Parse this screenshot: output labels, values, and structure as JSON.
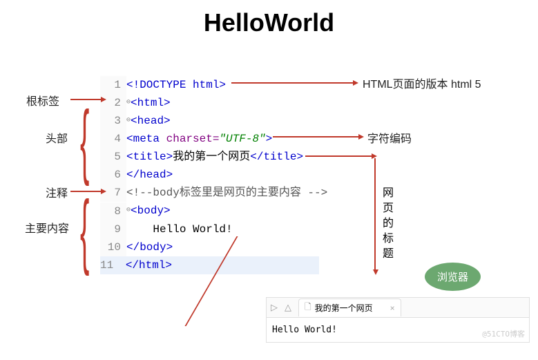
{
  "title": "HelloWorld",
  "code": {
    "l1": "<!DOCTYPE html>",
    "l2": "<html>",
    "l3": "<head>",
    "l4_tag_open": "<meta ",
    "l4_attr": "charset=",
    "l4_val": "\"UTF-8\"",
    "l4_tag_close": ">",
    "l5_open": "<title>",
    "l5_text": "我的第一个网页",
    "l5_close": "</title>",
    "l6": "</head>",
    "l7": "<!--body标签里是网页的主要内容 -->",
    "l8": "<body>",
    "l9": "    Hello World!",
    "l10": "</body>",
    "l11": "</html>"
  },
  "annotations": {
    "root_tag": "根标签",
    "head": "头部",
    "comment": "注释",
    "main_content": "主要内容",
    "version": "HTML页面的版本 html 5",
    "charset": "字符编码",
    "page_title": "网页的标题",
    "browser_label": "浏览器"
  },
  "browser": {
    "tab_title": "我的第一个网页",
    "body_text": "Hello World!"
  },
  "watermark": "@51CTO博客"
}
